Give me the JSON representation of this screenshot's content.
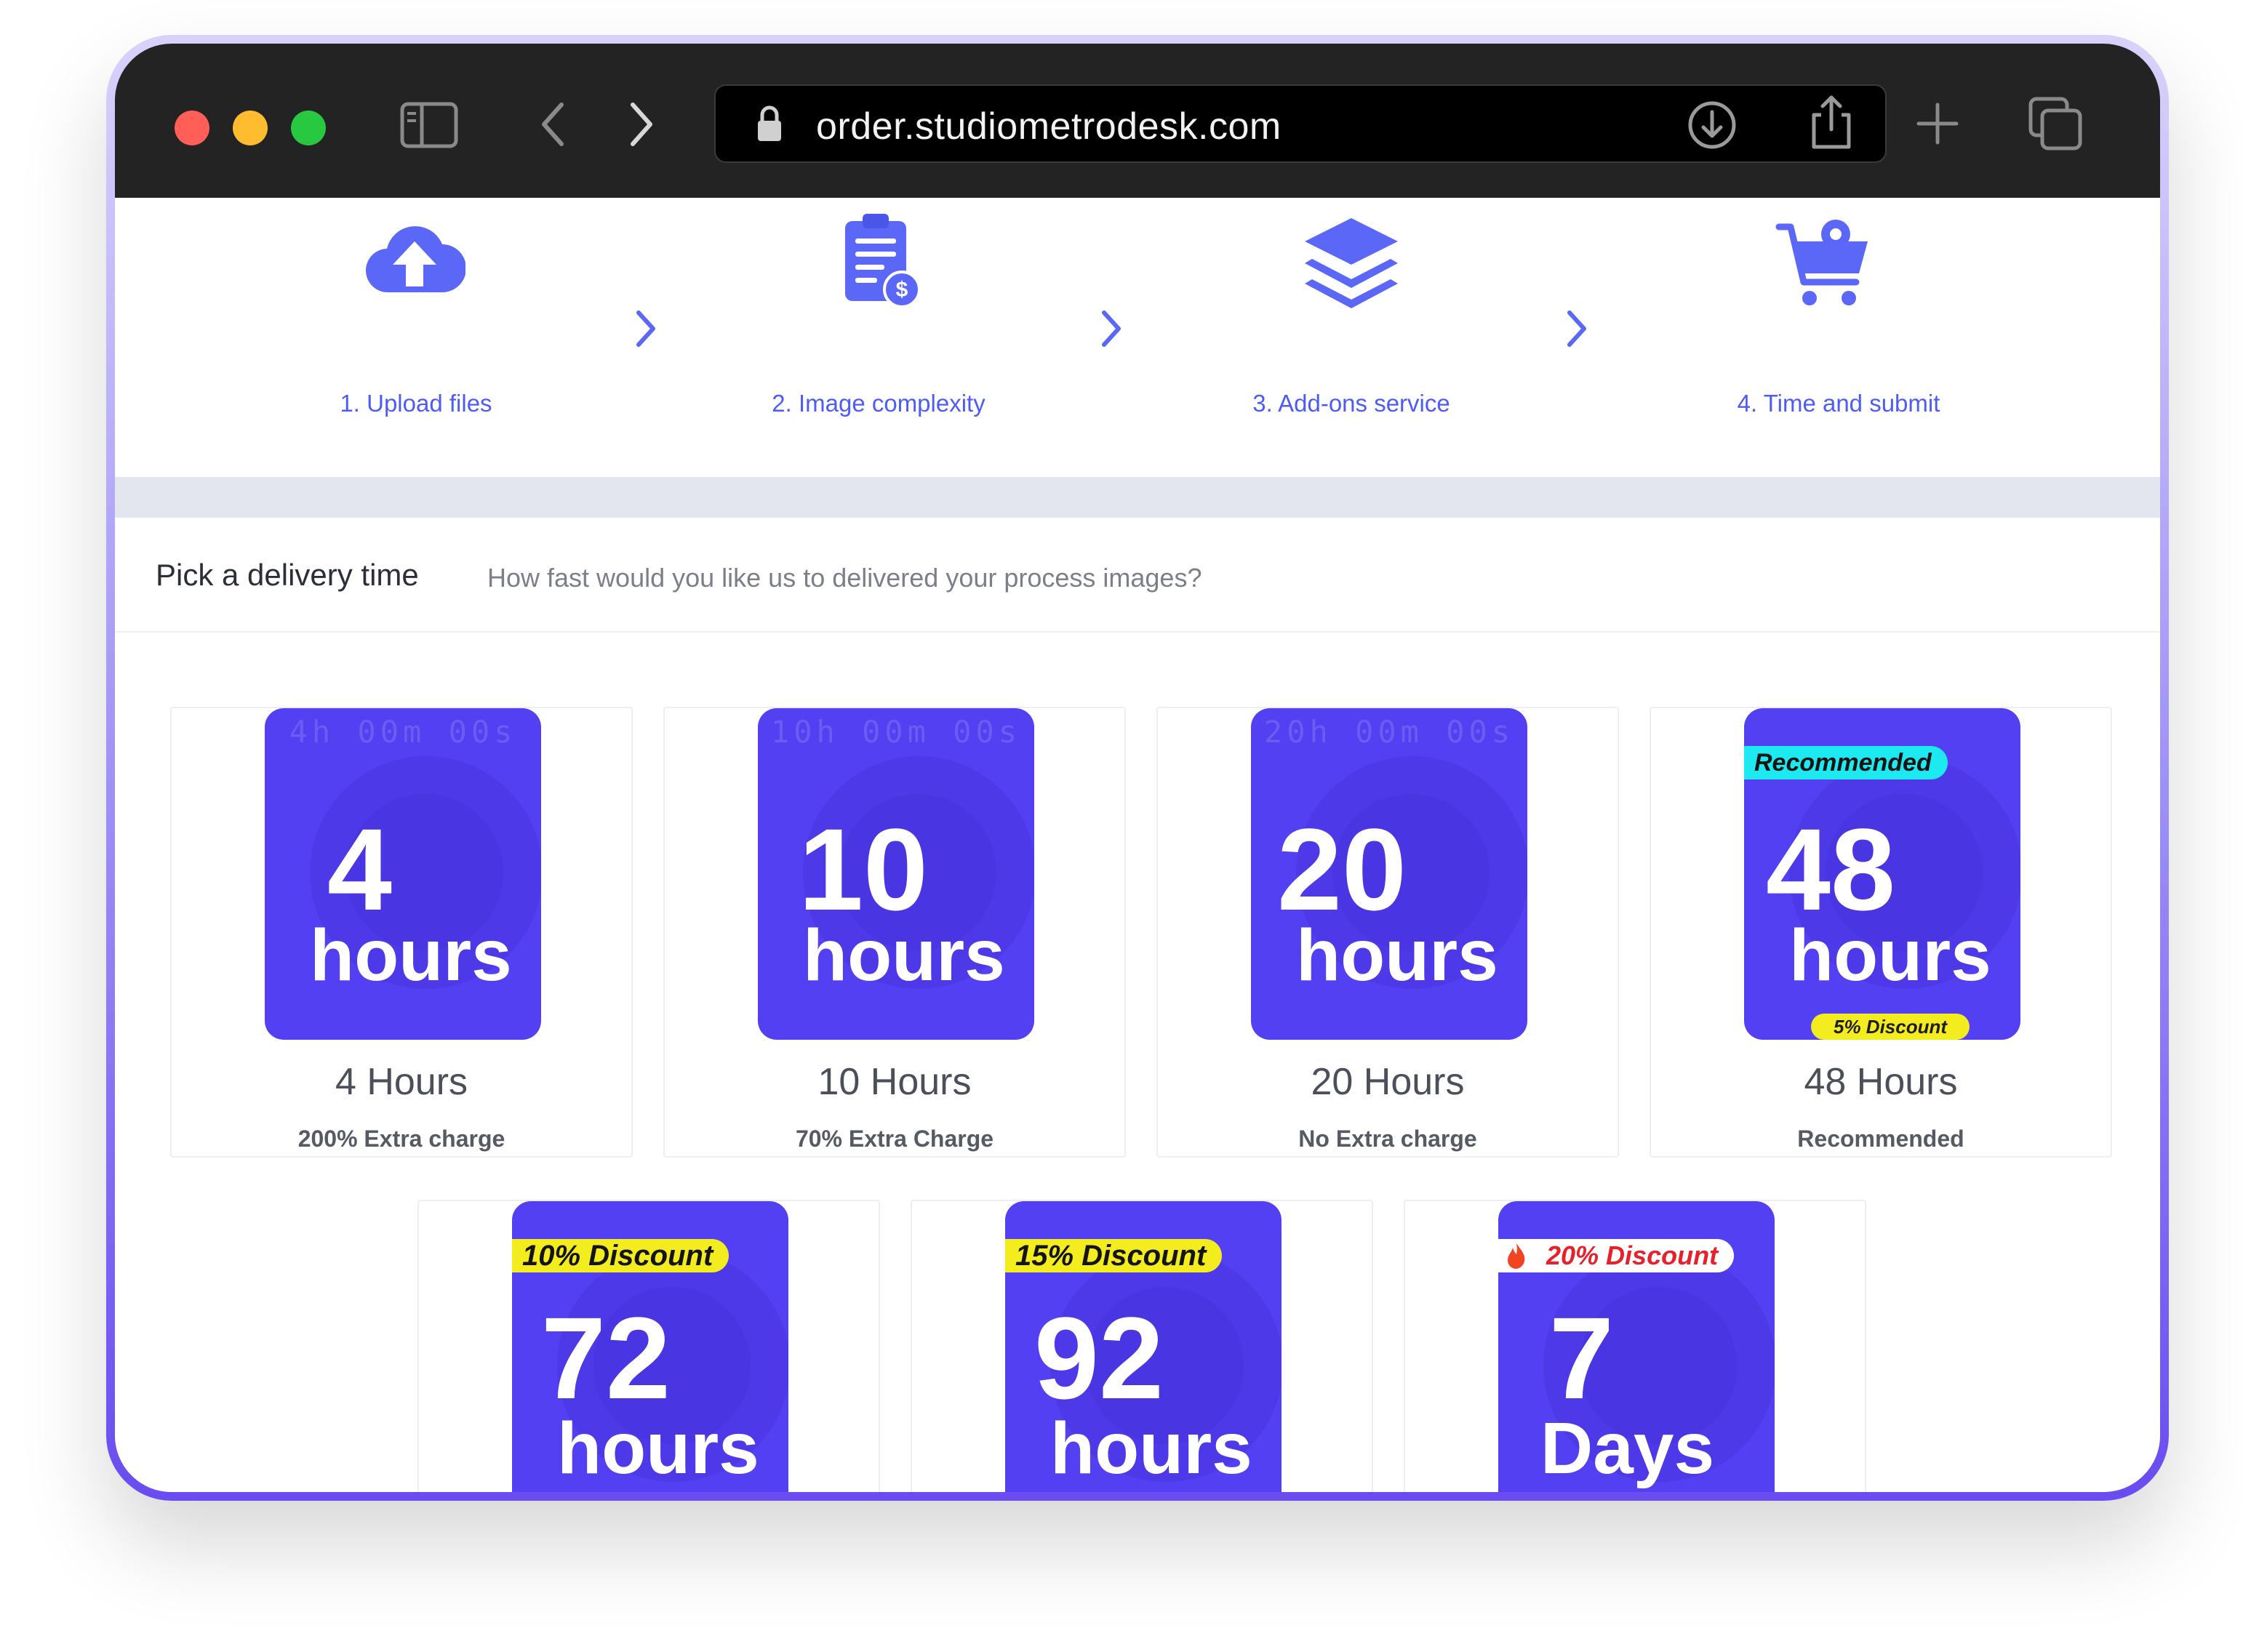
{
  "browser": {
    "url": "order.studiometrodesk.com"
  },
  "steps": [
    {
      "label": "1. Upload files",
      "icon": "cloud-upload-icon"
    },
    {
      "label": "2. Image complexity",
      "icon": "clipboard-price-icon"
    },
    {
      "label": "3. Add-ons service",
      "icon": "layers-icon"
    },
    {
      "label": "4. Time and submit",
      "icon": "cart-gear-icon"
    }
  ],
  "section": {
    "title": "Pick a delivery time",
    "subtitle": "How fast would you like us to delivered your process images?"
  },
  "options": [
    {
      "number": "4",
      "unit": "hours",
      "timer": "4h 00m 00s",
      "title": "4 Hours",
      "note": "200% Extra charge"
    },
    {
      "number": "10",
      "unit": "hours",
      "timer": "10h 00m 00s",
      "title": "10 Hours",
      "note": "70% Extra Charge"
    },
    {
      "number": "20",
      "unit": "hours",
      "timer": "20h 00m 00s",
      "title": "20 Hours",
      "note": "No Extra charge"
    },
    {
      "number": "48",
      "unit": "hours",
      "badge_top": "Recommended",
      "badge_bottom": "5% Discount",
      "title": "48 Hours",
      "note": "Recommended"
    },
    {
      "number": "72",
      "unit": "hours",
      "badge_top": "10% Discount"
    },
    {
      "number": "92",
      "unit": "hours",
      "badge_top": "15% Discount"
    },
    {
      "number": "7",
      "unit": "Days",
      "badge_top": "20% Discount"
    }
  ],
  "colors": {
    "accent": "#4d5cf6",
    "tile": "#5340f2",
    "badge_yellow": "#f3ec1e",
    "badge_cyan": "#1de9f0",
    "discount_red": "#e8202a"
  }
}
